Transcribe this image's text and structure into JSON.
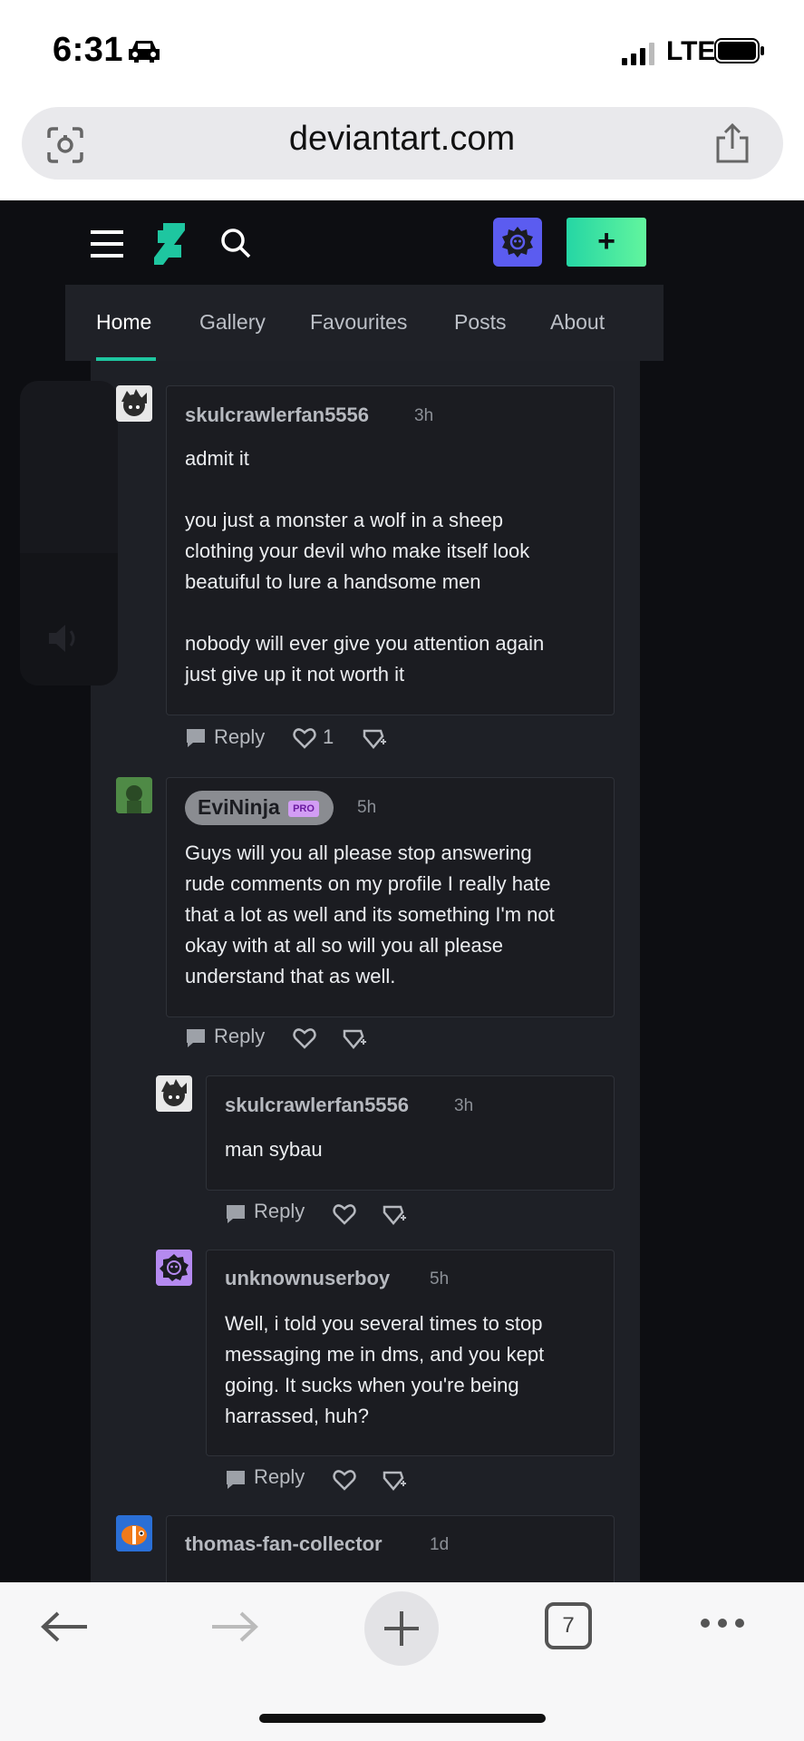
{
  "status_bar": {
    "time": "6:31",
    "network": "LTE"
  },
  "browser": {
    "url": "deviantart.com",
    "tab_count": "7"
  },
  "site_nav": {
    "create_label": "+"
  },
  "tabs": [
    {
      "label": "Home"
    },
    {
      "label": "Gallery"
    },
    {
      "label": "Favourites"
    },
    {
      "label": "Posts"
    },
    {
      "label": "About"
    }
  ],
  "comments": [
    {
      "username": "skulcrawlerfan5556",
      "age": "3h",
      "lines": [
        "admit it",
        "",
        "you just a monster a wolf in a sheep",
        "clothing your devil who make itself look",
        "beatuiful to lure a handsome men",
        "",
        "nobody will ever give you attention again",
        "just give up it not worth it"
      ],
      "reply_label": "Reply",
      "likes": "1"
    },
    {
      "username": "EviNinja",
      "badge": "PRO",
      "age": "5h",
      "lines": [
        "Guys will you all please stop answering",
        "rude comments on my profile I really hate",
        "that a lot as well and its something I'm not",
        "okay with at all so will you all please",
        "understand that as well."
      ],
      "reply_label": "Reply"
    },
    {
      "username": "skulcrawlerfan5556",
      "age": "3h",
      "lines": [
        "man sybau"
      ],
      "reply_label": "Reply"
    },
    {
      "username": "unknownuserboy",
      "age": "5h",
      "lines": [
        "Well, i told you several times to stop",
        "messaging me in dms, and you kept",
        "going. It sucks when you're being",
        "harrassed, huh?"
      ],
      "reply_label": "Reply"
    },
    {
      "username": "thomas-fan-collector",
      "age": "1d"
    }
  ],
  "colors": {
    "accent": "#1ec6a0",
    "avatar_purple": "#5b5cf0",
    "page_bg": "#0d0e12"
  }
}
